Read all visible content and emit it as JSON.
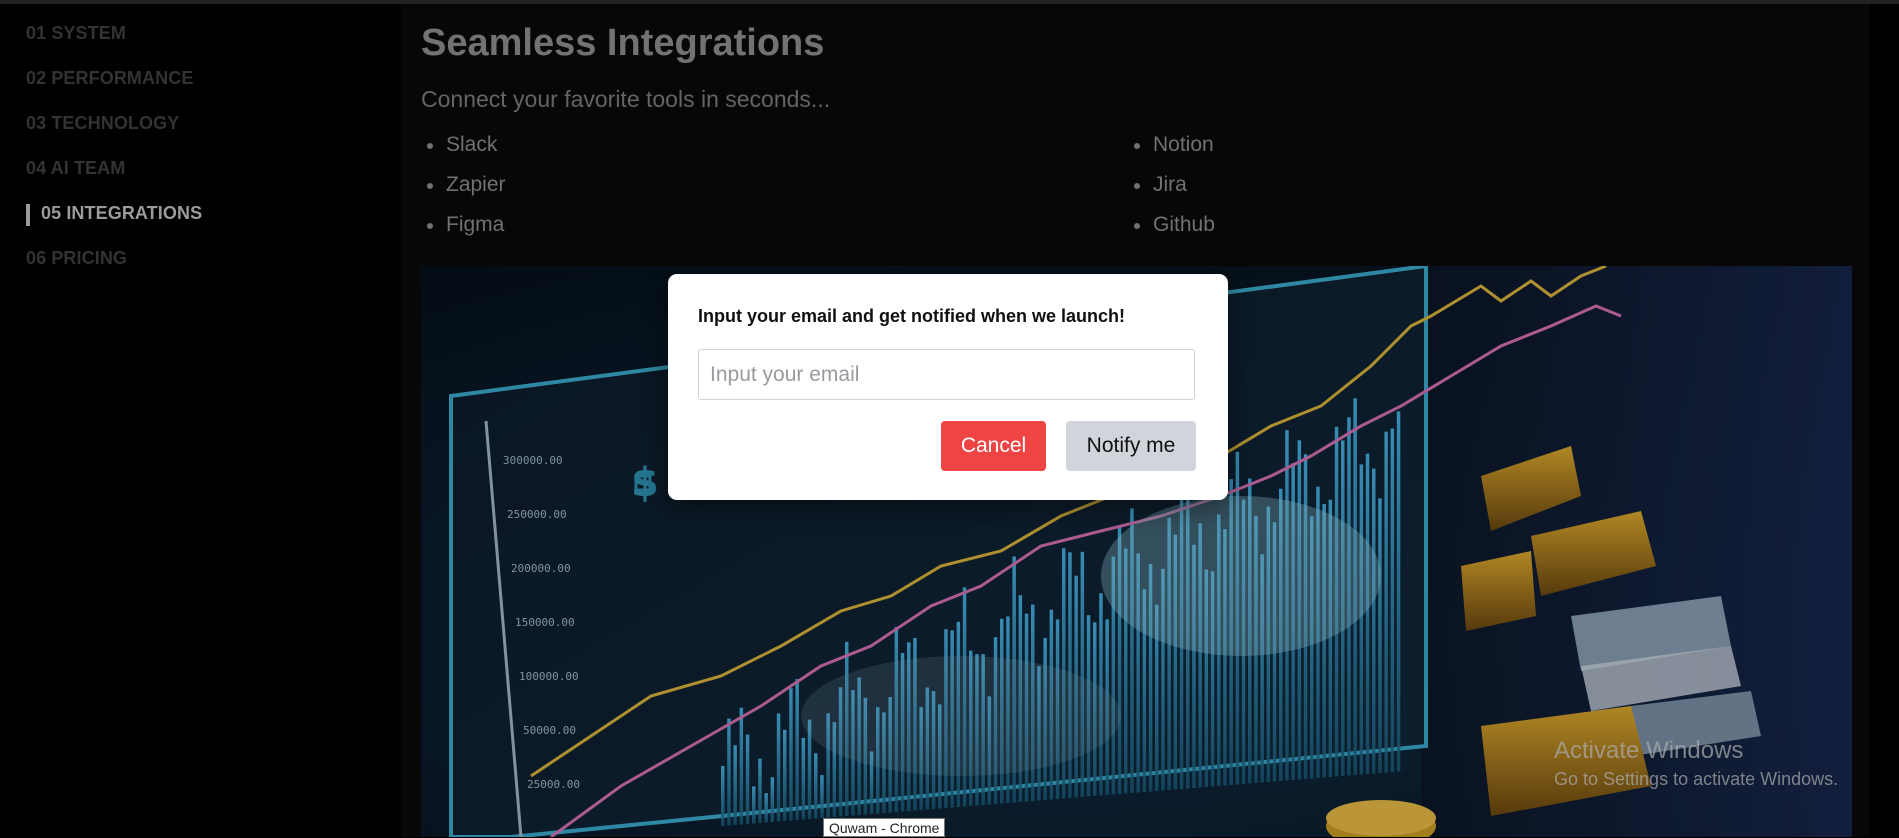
{
  "sidebar": {
    "items": [
      {
        "label": "01 SYSTEM"
      },
      {
        "label": "02 PERFORMANCE"
      },
      {
        "label": "03 TECHNOLOGY"
      },
      {
        "label": "04 AI TEAM"
      },
      {
        "label": "05 INTEGRATIONS",
        "active": true
      },
      {
        "label": "06 PRICING"
      }
    ]
  },
  "main": {
    "title": "Seamless Integrations",
    "subtitle": "Connect your favorite tools in seconds...",
    "integrations_left": [
      "Slack",
      "Zapier",
      "Figma"
    ],
    "integrations_right": [
      "Notion",
      "Jira",
      "Github"
    ]
  },
  "modal": {
    "title": "Input your email and get notified when we launch!",
    "email_placeholder": "Input your email",
    "email_value": "",
    "cancel_label": "Cancel",
    "notify_label": "Notify me"
  },
  "watermark": {
    "title": "Activate Windows",
    "subtitle": "Go to Settings to activate Windows."
  },
  "tooltip": {
    "text": "Quwam - Chrome"
  },
  "colors": {
    "accent_cancel": "#ef4444",
    "notify_bg": "#d1d5db",
    "sidebar_active": "#bdbdbd",
    "sidebar_inactive": "#3f3f3f"
  }
}
